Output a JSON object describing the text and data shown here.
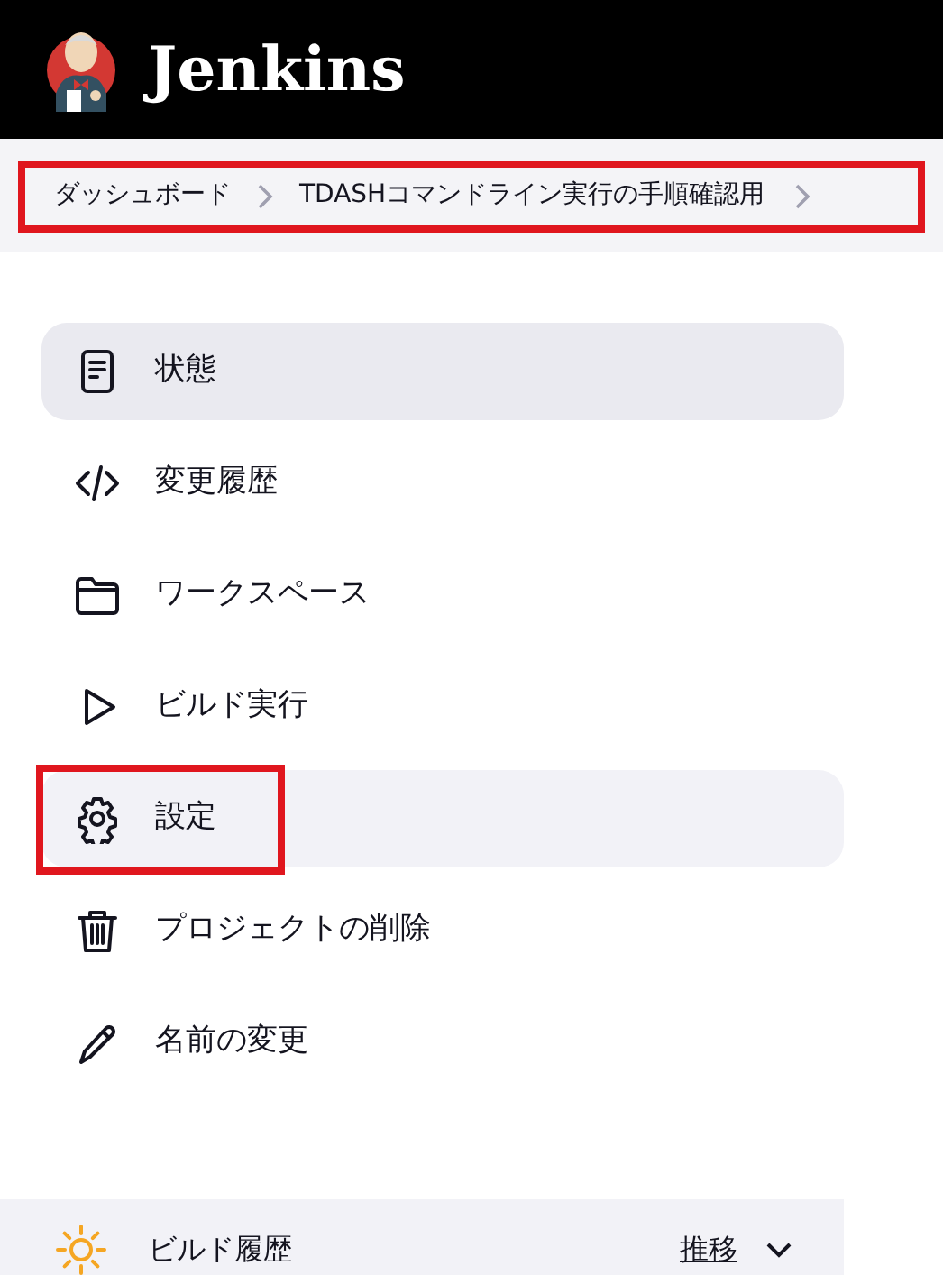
{
  "header": {
    "title": "Jenkins"
  },
  "breadcrumb": {
    "highlighted": true,
    "items": [
      "ダッシュボード",
      "TDASHコマンドライン実行の手順確認用"
    ]
  },
  "sidebar": {
    "items": [
      {
        "kind": "status",
        "label": "状態",
        "selected": true,
        "hovered": false,
        "highlighted": false
      },
      {
        "kind": "code",
        "label": "変更履歴",
        "selected": false,
        "hovered": false,
        "highlighted": false
      },
      {
        "kind": "folder",
        "label": "ワークスペース",
        "selected": false,
        "hovered": false,
        "highlighted": false
      },
      {
        "kind": "play",
        "label": "ビルド実行",
        "selected": false,
        "hovered": false,
        "highlighted": false
      },
      {
        "kind": "gear",
        "label": "設定",
        "selected": false,
        "hovered": true,
        "highlighted": true
      },
      {
        "kind": "trash",
        "label": "プロジェクトの削除",
        "selected": false,
        "hovered": false,
        "highlighted": false
      },
      {
        "kind": "pencil",
        "label": "名前の変更",
        "selected": false,
        "hovered": false,
        "highlighted": false
      }
    ]
  },
  "build_history": {
    "title": "ビルド履歴",
    "trend_link": "推移"
  }
}
